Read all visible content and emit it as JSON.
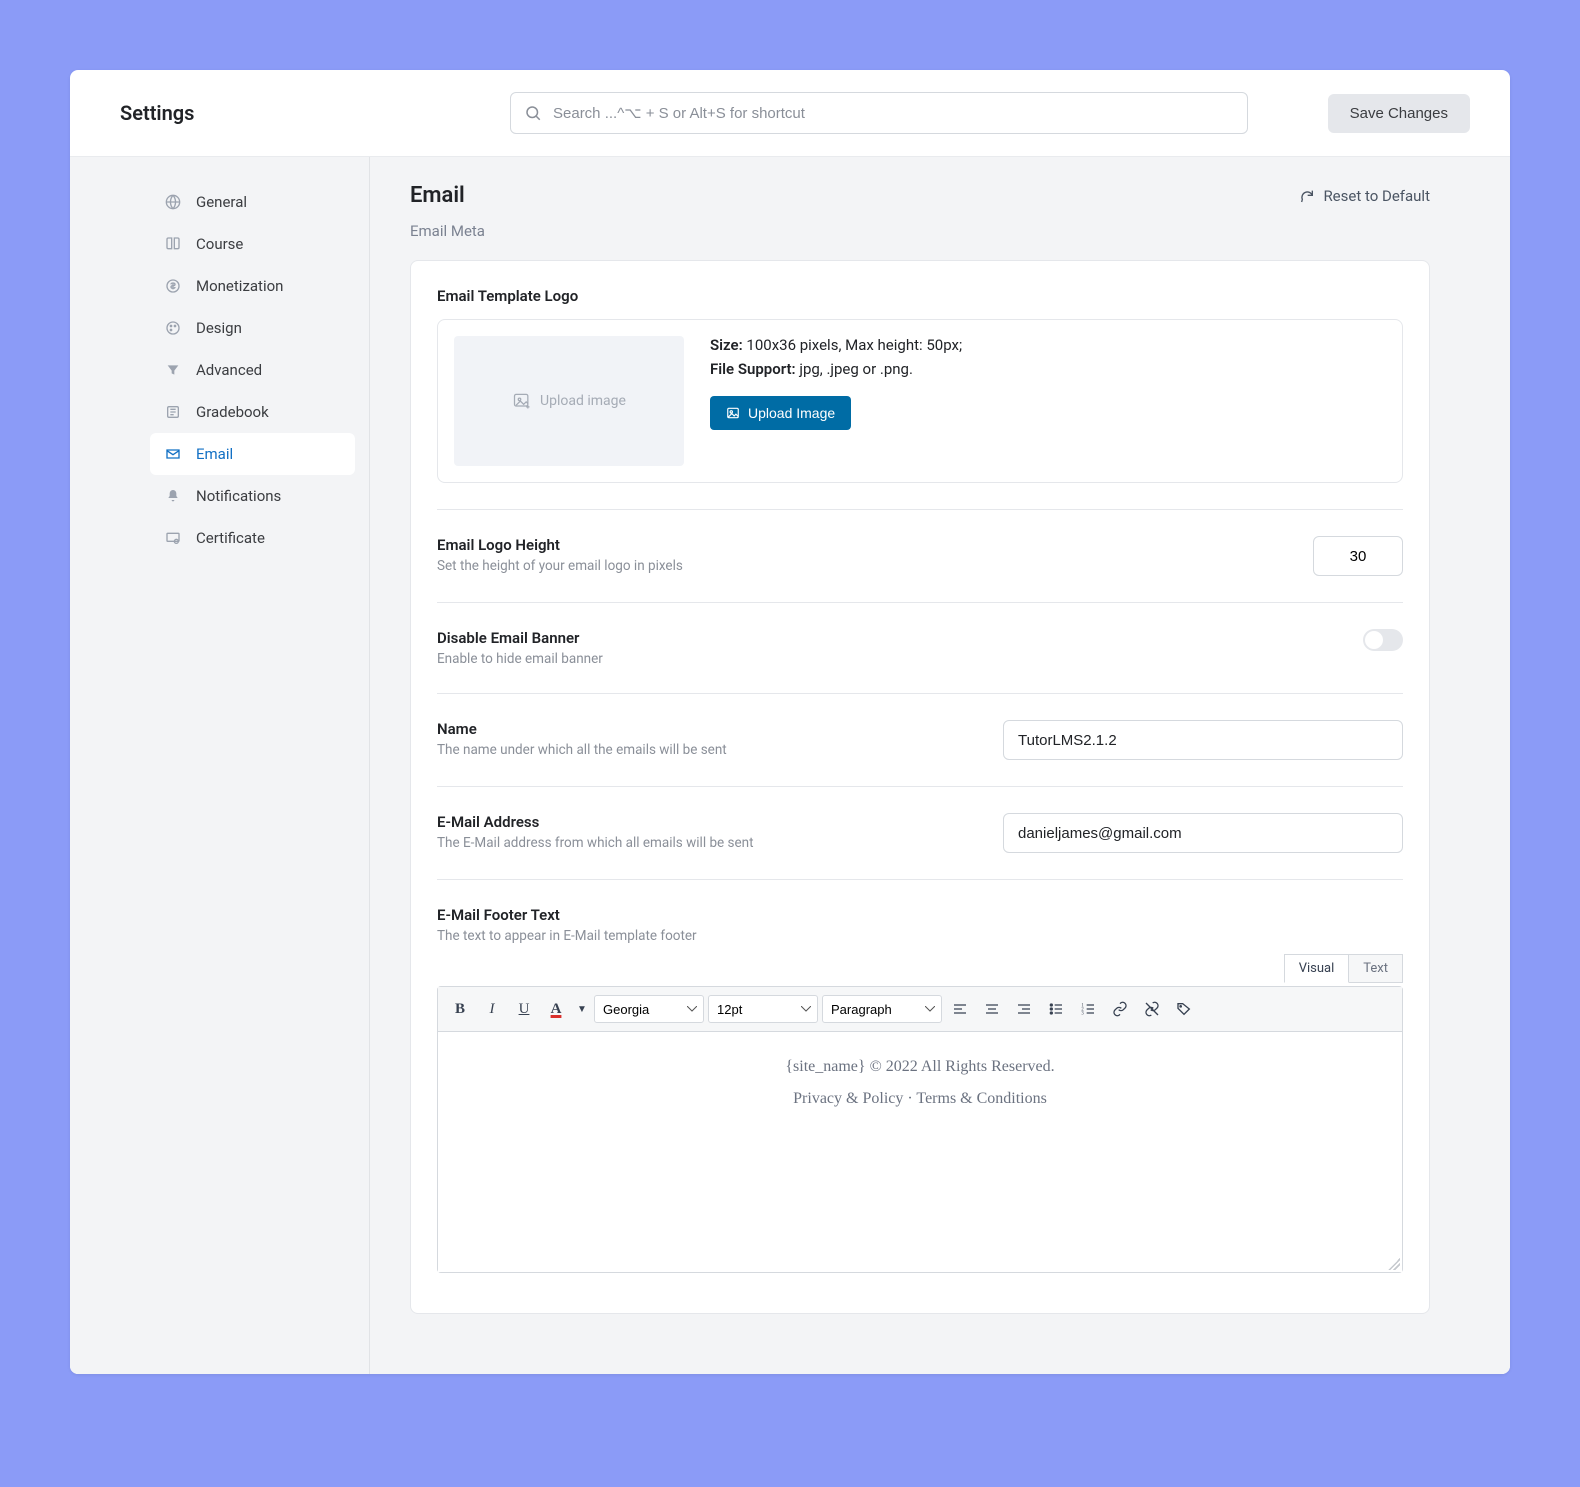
{
  "header": {
    "title": "Settings",
    "search_placeholder": "Search ...^⌥ + S or Alt+S for shortcut",
    "save_label": "Save Changes"
  },
  "sidebar": {
    "items": [
      {
        "label": "General"
      },
      {
        "label": "Course"
      },
      {
        "label": "Monetization"
      },
      {
        "label": "Design"
      },
      {
        "label": "Advanced"
      },
      {
        "label": "Gradebook"
      },
      {
        "label": "Email"
      },
      {
        "label": "Notifications"
      },
      {
        "label": "Certificate"
      }
    ]
  },
  "main": {
    "title": "Email",
    "reset_label": "Reset to Default",
    "section_sub": "Email Meta",
    "logo": {
      "title": "Email Template Logo",
      "preview_text": "Upload image",
      "size_label": "Size:",
      "size_value": "100x36 pixels, Max height: 50px;",
      "support_label": "File Support:",
      "support_value": "jpg, .jpeg or .png.",
      "button": "Upload Image"
    },
    "height": {
      "title": "Email Logo Height",
      "desc": "Set the height of your email logo in pixels",
      "value": "30"
    },
    "banner": {
      "title": "Disable Email Banner",
      "desc": "Enable to hide email banner"
    },
    "name": {
      "title": "Name",
      "desc": "The name under which all the emails will be sent",
      "value": "TutorLMS2.1.2"
    },
    "email": {
      "title": "E-Mail Address",
      "desc": "The E-Mail address from which all emails will be sent",
      "value": "danieljames@gmail.com"
    },
    "footer": {
      "title": "E-Mail Footer Text",
      "desc": "The text to appear in E-Mail template footer"
    },
    "editor": {
      "tabs": {
        "visual": "Visual",
        "text": "Text"
      },
      "font": "Georgia",
      "size": "12pt",
      "format": "Paragraph",
      "content_line1": "{site_name} © 2022 All Rights Reserved.",
      "content_line2": "Privacy & Policy · Terms & Conditions"
    }
  }
}
